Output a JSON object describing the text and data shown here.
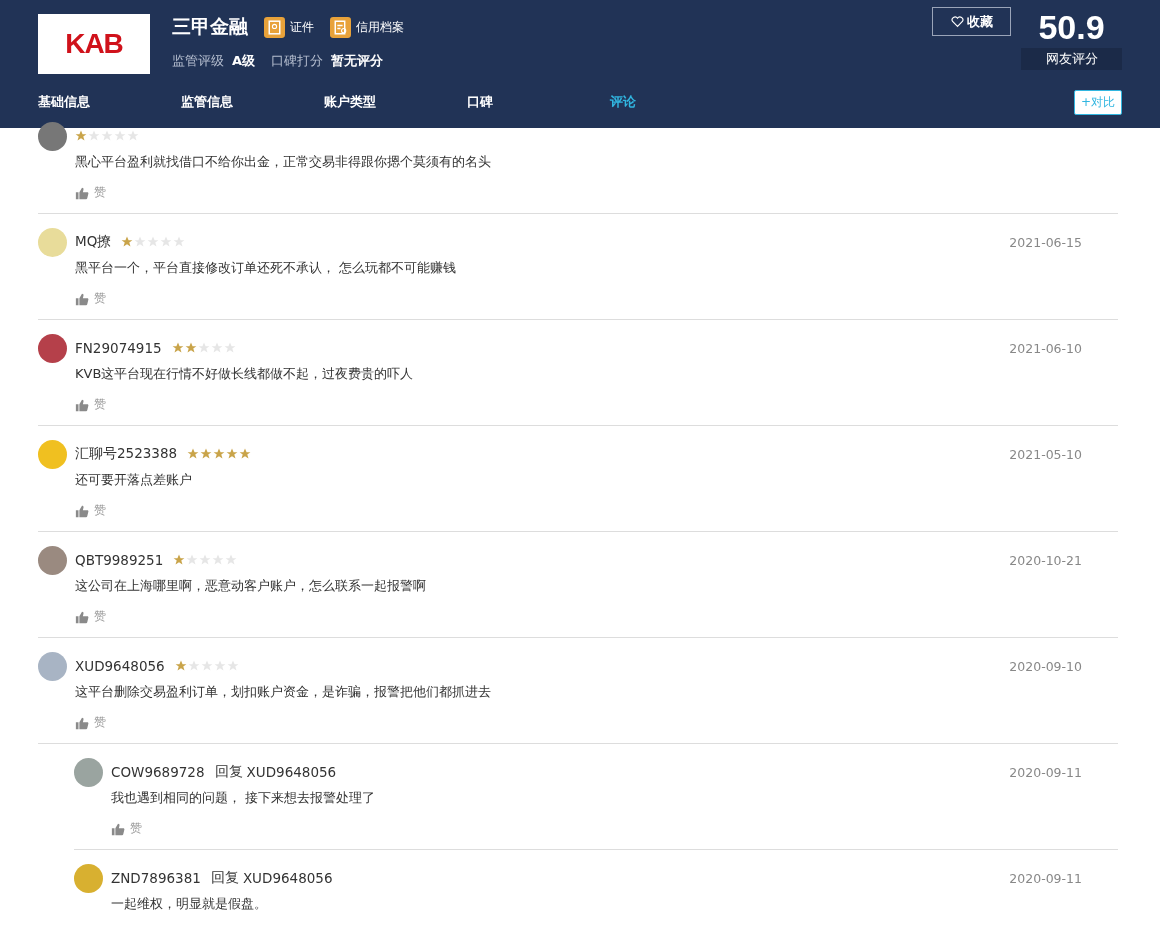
{
  "header": {
    "logo_text": "KAB",
    "company": "三甲金融",
    "badges": [
      {
        "kind": "license",
        "label": "证件"
      },
      {
        "kind": "credit",
        "label": "信用档案"
      }
    ],
    "regulation_label": "监管评级",
    "regulation_value": "A级",
    "reputation_label": "口碑打分",
    "reputation_value": "暂无评分",
    "favorite_button": "收藏",
    "score": "50.9",
    "score_label": "网友评分"
  },
  "tabs": [
    {
      "label": "基础信息",
      "selected": false
    },
    {
      "label": "监管信息",
      "selected": false
    },
    {
      "label": "账户类型",
      "selected": false
    },
    {
      "label": "口碑",
      "selected": false
    },
    {
      "label": "评论",
      "selected": true
    }
  ],
  "compare_button": "+对比",
  "comments": [
    {
      "kind": "partial",
      "stars": 1,
      "text": "黑心平台盈利就找借口不给你出金，正常交易非得跟你摁个莫须有的名头",
      "like": "赞"
    },
    {
      "kind": "full",
      "author": "MQ撩",
      "stars": 1,
      "date": "2021-06-15",
      "text": "黑平台一个，平台直接修改订单还死不承认， 怎么玩都不可能赚钱",
      "like": "赞"
    },
    {
      "kind": "full",
      "author": "FN29074915",
      "stars": 2,
      "date": "2021-06-10",
      "text": "KVB这平台现在行情不好做长线都做不起，过夜费贵的吓人",
      "like": "赞"
    },
    {
      "kind": "full",
      "author": "汇聊号2523388",
      "stars": 5,
      "date": "2021-05-10",
      "text": "还可要开落点差账户",
      "like": "赞"
    },
    {
      "kind": "full",
      "author": "QBT9989251",
      "stars": 1,
      "date": "2020-10-21",
      "text": "这公司在上海哪里啊，恶意动客户账户，怎么联系一起报警啊",
      "like": "赞"
    },
    {
      "kind": "full",
      "author": "XUD9648056",
      "stars": 1,
      "date": "2020-09-10",
      "text": "这平台删除交易盈利订单，划扣账户资金，是诈骗，报警把他们都抓进去",
      "like": "赞",
      "replies": [
        {
          "author": "COW9689728",
          "reply_label": "回复",
          "reply_to": "XUD9648056",
          "date": "2020-09-11",
          "text": "我也遇到相同的问题， 接下来想去报警处理了",
          "like": "赞"
        },
        {
          "author": "ZND7896381",
          "reply_label": "回复",
          "reply_to": "XUD9648056",
          "date": "2020-09-11",
          "text": "一起维权，明显就是假盘。"
        }
      ]
    }
  ]
}
